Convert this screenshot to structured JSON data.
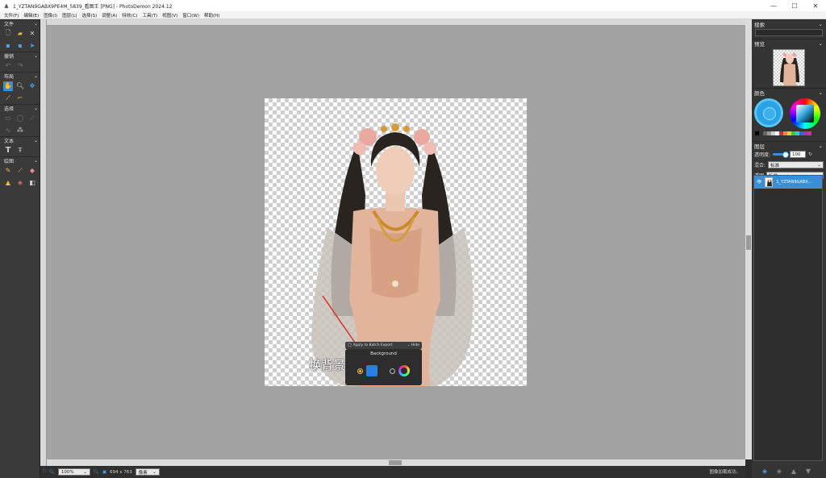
{
  "window": {
    "title": "1_YZTAN9GABX9PE4M_5839_看图王 [PNG]  -  PhotoDemon 2024.12",
    "minimize": "—",
    "maximize": "☐",
    "close": "✕"
  },
  "menu": [
    "文件(F)",
    "编辑(E)",
    "图像(I)",
    "图层(L)",
    "选择(S)",
    "调整(A)",
    "特效(C)",
    "工具(T)",
    "视图(V)",
    "窗口(W)",
    "帮助(H)"
  ],
  "toolbox": {
    "file": "文件",
    "undo": "撤销",
    "layout": "布局",
    "select": "选择",
    "text": "文本",
    "paint": "绘图"
  },
  "canvas": {
    "overlay_text": "换背景",
    "popup_apply": "Apply to Batch Export",
    "popup_hide": "Hide",
    "popup_title": "Background"
  },
  "status": {
    "zoom": "100%",
    "size": "694 x 763",
    "unit": "像素",
    "message": "图像加载成功。"
  },
  "right_panel": {
    "search": "搜索",
    "preview": "预览",
    "color": "颜色",
    "layers": "图层",
    "opacity_label": "透明度:",
    "opacity_value": "100",
    "blend_label": "混合:",
    "blend_value": "标准",
    "alpha_label": "透明",
    "alpha_value": "标准",
    "layer_name": "1_YZTAN9GABX..."
  },
  "accent_color": "#3a8fd4"
}
